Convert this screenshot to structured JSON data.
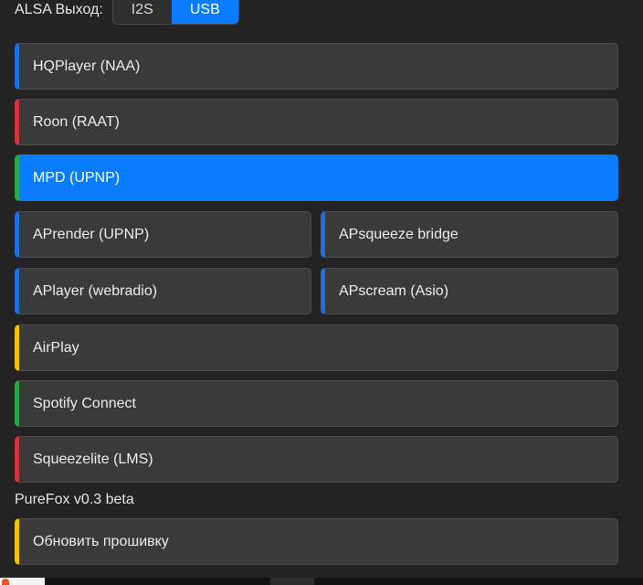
{
  "alsa": {
    "label": "ALSA Выход:",
    "options": [
      "I2S",
      "USB"
    ],
    "selected": "USB"
  },
  "services": [
    {
      "label": "HQPlayer (NAA)",
      "accent": "#1e6fe0",
      "active": false
    },
    {
      "label": "Roon (RAAT)",
      "accent": "#d2343f",
      "active": false
    },
    {
      "label": "MPD (UPNP)",
      "accent": "#27a745",
      "active": true
    },
    {
      "label": "APrender (UPNP)",
      "accent": "#1e6fe0",
      "active": false
    },
    {
      "label": "APsqueeze bridge",
      "accent": "#1e6fe0",
      "active": false
    },
    {
      "label": "APlayer (webradio)",
      "accent": "#1e6fe0",
      "active": false
    },
    {
      "label": "APscream (Asio)",
      "accent": "#1e6fe0",
      "active": false
    },
    {
      "label": "AirPlay",
      "accent": "#f2c200",
      "active": false
    },
    {
      "label": "Spotify Connect",
      "accent": "#27a745",
      "active": false
    },
    {
      "label": "Squeezelite (LMS)",
      "accent": "#d2343f",
      "active": false
    }
  ],
  "footer": {
    "version": "PureFox v0.3 beta",
    "update_label": "Обновить прошивку",
    "update_accent": "#f2c200"
  },
  "colors": {
    "background": "#232323",
    "active": "#0a7cff",
    "card": "#3a3a3a"
  }
}
